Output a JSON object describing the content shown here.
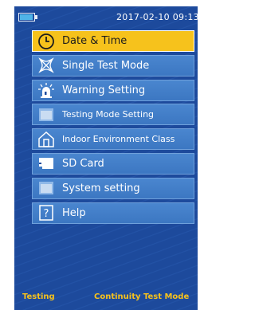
{
  "status": {
    "datetime": "2017-02-10 09:13"
  },
  "menu": {
    "items": [
      {
        "label": "Date & Time",
        "icon": "clock-icon",
        "selected": true
      },
      {
        "label": "Single Test Mode",
        "icon": "network-icon",
        "selected": false
      },
      {
        "label": "Warning Setting",
        "icon": "alarm-light-icon",
        "selected": false
      },
      {
        "label": "Testing Mode Setting",
        "icon": "window-icon",
        "selected": false
      },
      {
        "label": "Indoor Environment Class",
        "icon": "house-icon",
        "selected": false
      },
      {
        "label": "SD Card",
        "icon": "sd-card-icon",
        "selected": false
      },
      {
        "label": "System setting",
        "icon": "window-icon",
        "selected": false
      },
      {
        "label": "Help",
        "icon": "help-icon",
        "selected": false
      }
    ]
  },
  "bottom": {
    "left": "Testing",
    "right": "Continuity Test Mode"
  },
  "colors": {
    "background": "#1d4a9c",
    "menu_item": "#4a86cf",
    "selected": "#f6c21c",
    "bottom_text": "#f6c21c"
  }
}
